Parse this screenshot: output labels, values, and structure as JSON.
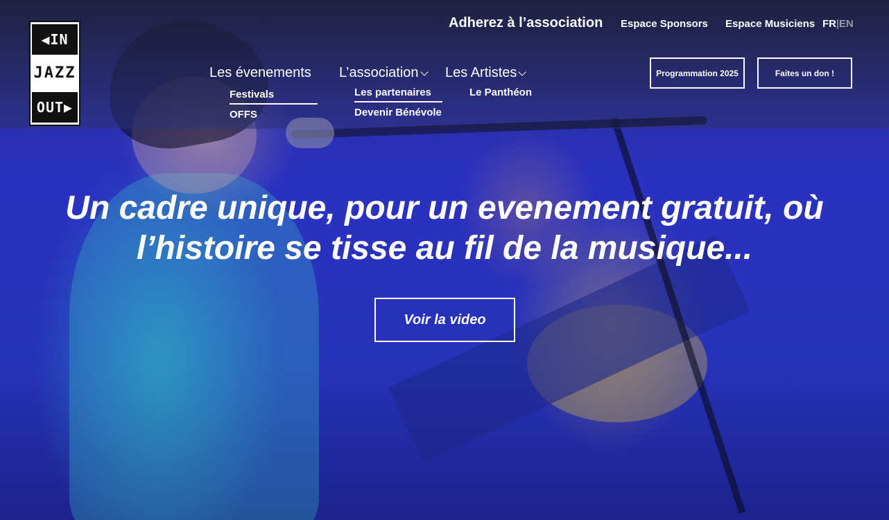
{
  "logo": {
    "top_text": "IN",
    "middle_text_1": "JAZZ",
    "bottom_text": "OUT"
  },
  "utility_nav": {
    "join": "Adherez à l’association",
    "sponsors": "Espace Sponsors",
    "musicians": "Espace Musiciens",
    "lang_fr": "FR",
    "lang_sep": "|",
    "lang_en": "EN"
  },
  "main_nav": {
    "evenements": {
      "label": "Les évenements",
      "sub": [
        "Festivals",
        "OFFS"
      ]
    },
    "association": {
      "label": "L’association",
      "sub": [
        "Les partenaires",
        "Devenir Bénévole"
      ]
    },
    "artistes": {
      "label": "Les Artistes",
      "sub": [
        "Le Panthéon"
      ]
    }
  },
  "buttons": {
    "programmation": "Programmation 2025",
    "donation": "Faites un don !"
  },
  "hero": {
    "title": "Un cadre unique, pour un evenement gratuit, où l’histoire se tisse au fil de la musique...",
    "video_button": "Voir la video"
  }
}
